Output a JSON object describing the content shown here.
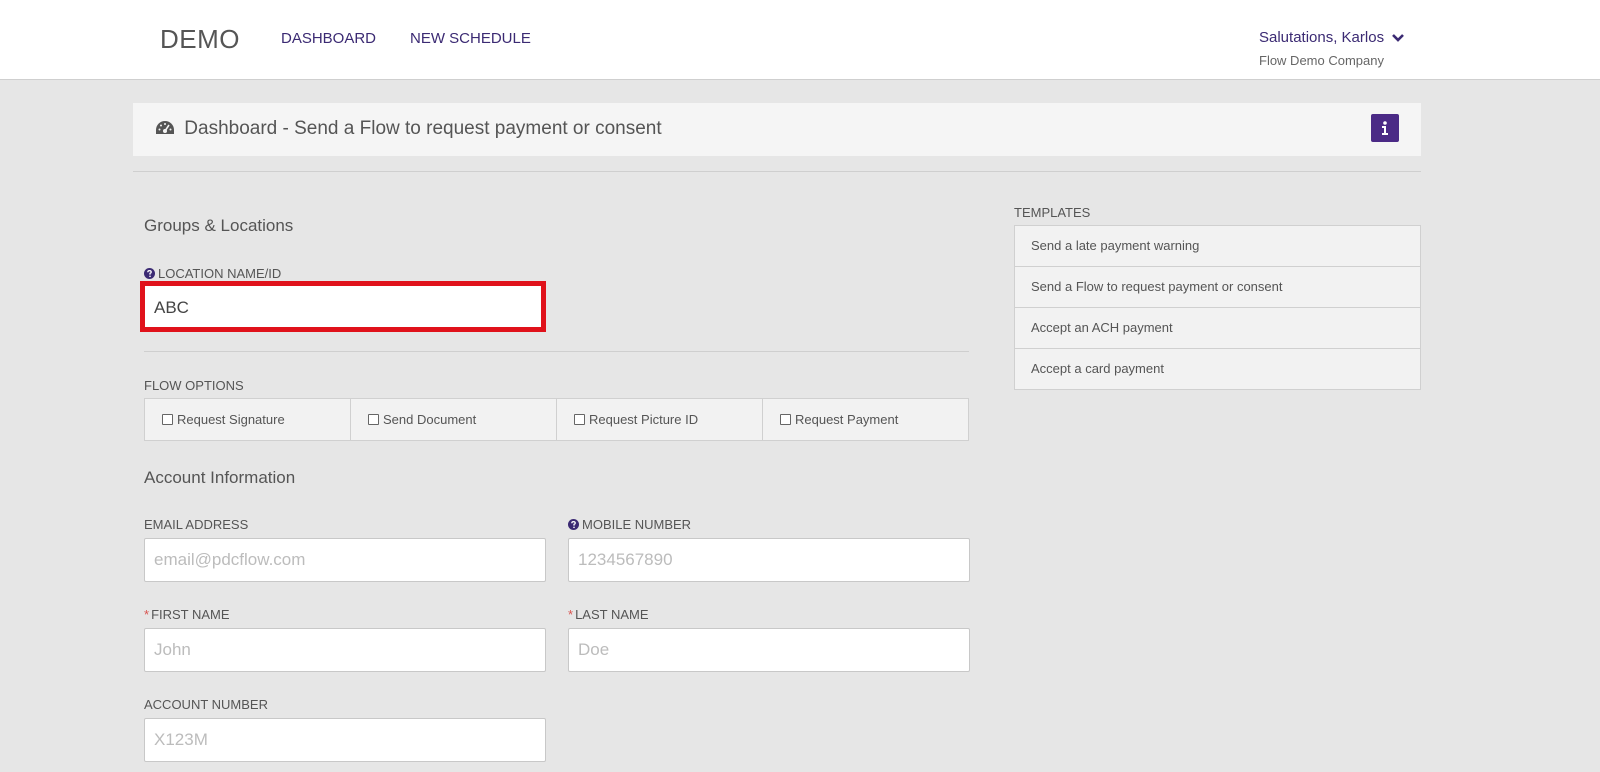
{
  "topbar": {
    "brand": "DEMO",
    "nav": {
      "dashboard": "DASHBOARD",
      "new_schedule": "NEW SCHEDULE"
    },
    "user_greeting": "Salutations, Karlos",
    "company": "Flow Demo Company"
  },
  "header": {
    "title": "Dashboard - Send a Flow to request payment or consent",
    "icon": "dashboard-gauge-icon",
    "info_icon": "info-icon"
  },
  "groups": {
    "section_title": "Groups & Locations",
    "location_label": "LOCATION NAME/ID",
    "location_value": "ABC"
  },
  "flow_options": {
    "label": "FLOW OPTIONS",
    "items": [
      "Request Signature",
      "Send Document",
      "Request Picture ID",
      "Request Payment"
    ]
  },
  "account": {
    "section_title": "Account Information",
    "email_label": "EMAIL ADDRESS",
    "email_placeholder": "email@pdcflow.com",
    "mobile_label": "MOBILE NUMBER",
    "mobile_placeholder": "1234567890",
    "first_name_label": "FIRST NAME",
    "first_name_placeholder": "John",
    "last_name_label": "LAST NAME",
    "last_name_placeholder": "Doe",
    "account_number_label": "ACCOUNT NUMBER",
    "account_number_placeholder": "X123M",
    "required_marker": "*"
  },
  "templates": {
    "label": "TEMPLATES",
    "items": [
      "Send a late payment warning",
      "Send a Flow to request payment or consent",
      "Accept an ACH payment",
      "Accept a card payment"
    ]
  },
  "colors": {
    "accent": "#4b2a86",
    "nav_text": "#3b2a73",
    "highlight": "#e0121b",
    "required": "#d9534f"
  }
}
